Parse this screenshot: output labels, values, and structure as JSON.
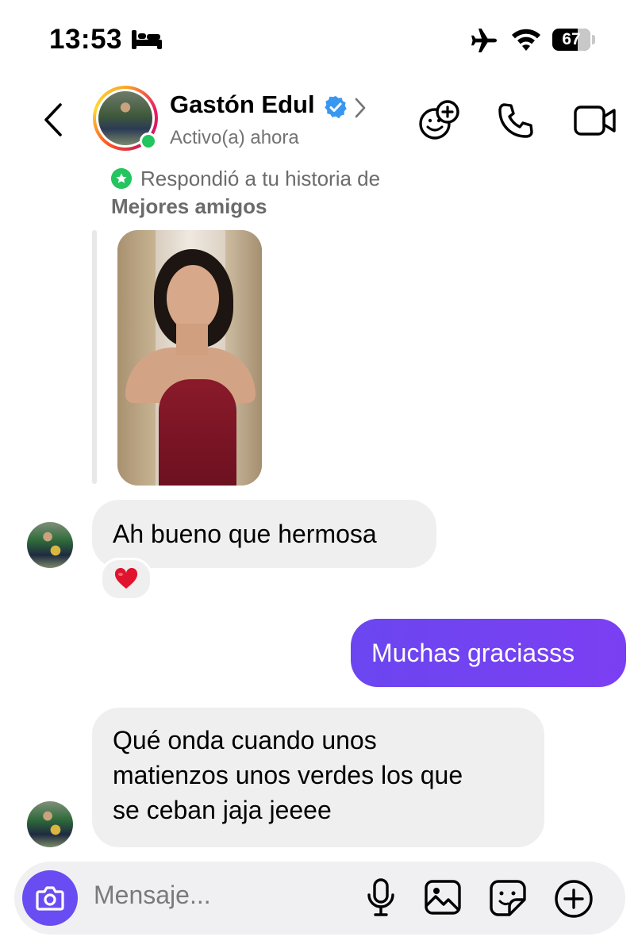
{
  "status_bar": {
    "time": "13:53",
    "battery": "67",
    "icons": [
      "bed-icon",
      "airplane-icon",
      "wifi-icon",
      "battery-icon"
    ]
  },
  "header": {
    "contact_name": "Gastón Edul",
    "status": "Activo(a) ahora",
    "icons": [
      "back-icon",
      "verified-badge-icon",
      "chevron-right-icon",
      "effects-icon",
      "phone-icon",
      "video-camera-icon"
    ]
  },
  "reply_context": {
    "line1": "Respondió a tu historia de",
    "line2": "Mejores amigos"
  },
  "messages": [
    {
      "from": "contact",
      "text": "Ah bueno que hermosa",
      "reaction": "heart"
    },
    {
      "from": "me",
      "text": "Muchas graciasss"
    },
    {
      "from": "contact",
      "lines": [
        "Qué onda cuando unos",
        "matienzos unos verdes los que",
        "se ceban jaja jeeee"
      ]
    }
  ],
  "composer": {
    "placeholder": "Mensaje...",
    "icons": [
      "camera-icon",
      "microphone-icon",
      "gallery-icon",
      "sticker-icon",
      "plus-icon"
    ]
  },
  "colors": {
    "accent": "#6a4cf3",
    "online": "#22c55e",
    "incoming_bubble": "#efefef"
  }
}
